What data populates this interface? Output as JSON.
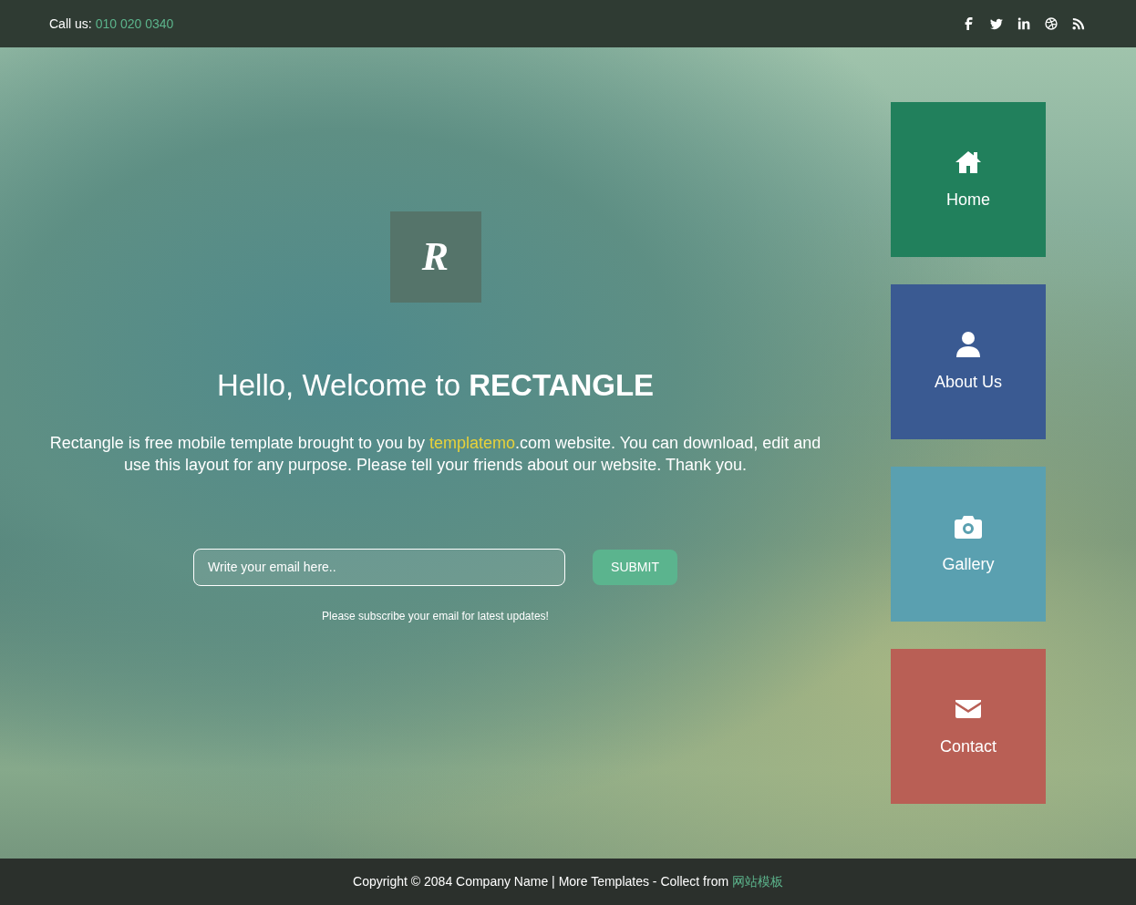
{
  "top_bar": {
    "call_label": "Call us:",
    "phone": "010 020 0340",
    "social": [
      {
        "kind": "facebook"
      },
      {
        "kind": "twitter"
      },
      {
        "kind": "linkedin"
      },
      {
        "kind": "dribbble"
      },
      {
        "kind": "rss"
      }
    ]
  },
  "hero": {
    "logo": "R",
    "heading": "Hello, Welcome to **RECTANGLE**",
    "intro_before": "Rectangle is free mobile template brought to you by ",
    "intro_link": "templatemo",
    "intro_after": ".com website. You can download, edit and use this layout for any purpose. Please tell your friends about our website. Thank you.",
    "email_placeholder": "Write your email here..",
    "submit": "SUBMIT",
    "note": "Please subscribe your email for latest updates!"
  },
  "tiles": [
    {
      "label": "Home",
      "kind": "home",
      "color": "#21805c"
    },
    {
      "label": "About Us",
      "kind": "user",
      "color": "#3a5a92"
    },
    {
      "label": "Gallery",
      "kind": "camera",
      "color": "#5aa0b0"
    },
    {
      "label": "Contact",
      "kind": "envelope",
      "color": "#b95f55"
    }
  ],
  "footer": {
    "text": "Copyright © 2084 Company Name | More Templates - Collect from ",
    "link": "网站模板"
  }
}
